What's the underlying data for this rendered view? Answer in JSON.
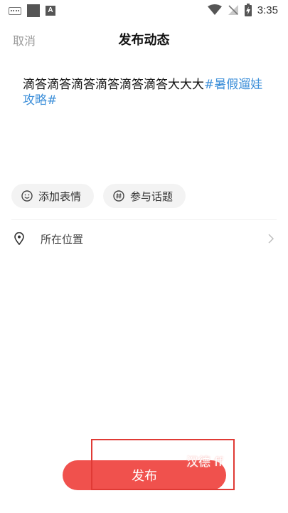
{
  "status_bar": {
    "time": "3:35"
  },
  "header": {
    "cancel_label": "取消",
    "title": "发布动态"
  },
  "post": {
    "body_text": "滴答滴答滴答滴答滴答滴答大大大",
    "hashtag_text": "#暑假遛娃攻略#"
  },
  "chips": {
    "emoji_label": "添加表情",
    "topic_label": "参与话题"
  },
  "location": {
    "label": "所在位置"
  },
  "footer": {
    "publish_label": "发布",
    "overlay_text": "汉德 ff"
  },
  "colors": {
    "accent": "#f0514d",
    "hashtag": "#3d8fd9",
    "highlight_border": "#e03a35"
  }
}
